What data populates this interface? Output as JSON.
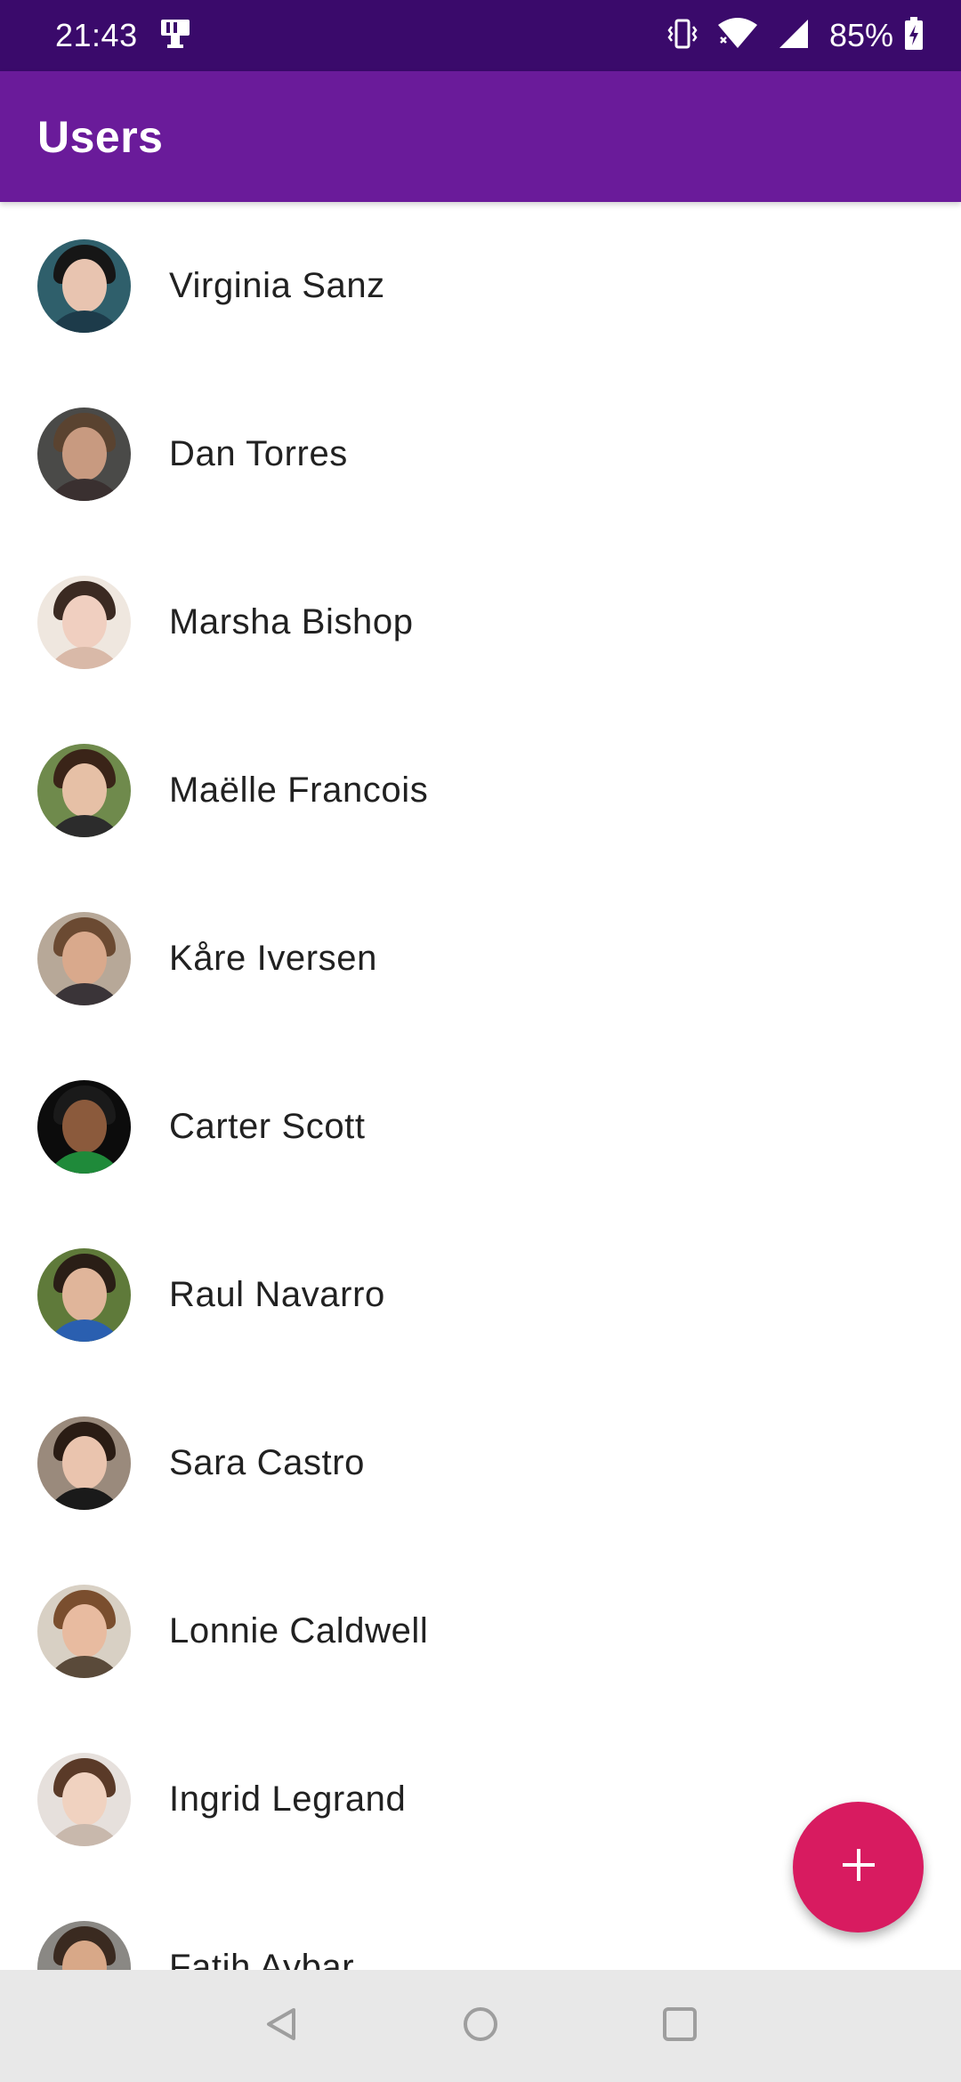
{
  "status_bar": {
    "time": "21:43",
    "battery_percent": "85%",
    "icons": [
      "screen-cast-icon",
      "vibrate-icon",
      "wifi-icon",
      "signal-icon",
      "battery-charging-icon"
    ]
  },
  "app_bar": {
    "title": "Users",
    "color": "#6a1b9a"
  },
  "users": [
    {
      "name": "Virginia Sanz",
      "avatar": {
        "bg": "#2f5f6b",
        "face": "#e8c4b0",
        "hair": "#161616",
        "shirt": "#1d3b4a"
      }
    },
    {
      "name": "Dan Torres",
      "avatar": {
        "bg": "#4a4a48",
        "face": "#c89a80",
        "hair": "#5a4330",
        "shirt": "#3a3030"
      }
    },
    {
      "name": "Marsha Bishop",
      "avatar": {
        "bg": "#efe7df",
        "face": "#f0cfc0",
        "hair": "#3b2a22",
        "shirt": "#d9b9a8"
      }
    },
    {
      "name": "Maëlle Francois",
      "avatar": {
        "bg": "#6f8a4c",
        "face": "#e6c0a6",
        "hair": "#3a2418",
        "shirt": "#2c2c2c"
      }
    },
    {
      "name": "Kåre Iversen",
      "avatar": {
        "bg": "#b7a898",
        "face": "#d9a98c",
        "hair": "#6b4a32",
        "shirt": "#3a3438"
      }
    },
    {
      "name": "Carter Scott",
      "avatar": {
        "bg": "#0c0c0c",
        "face": "#8b5a3c",
        "hair": "#1a1a1a",
        "shirt": "#1f8a3a"
      }
    },
    {
      "name": "Raul Navarro",
      "avatar": {
        "bg": "#5f7a3a",
        "face": "#e0b59a",
        "hair": "#2a1e16",
        "shirt": "#2a5fb0"
      }
    },
    {
      "name": "Sara Castro",
      "avatar": {
        "bg": "#9a8a7c",
        "face": "#eac4ae",
        "hair": "#2a1c14",
        "shirt": "#1a1a1a"
      }
    },
    {
      "name": "Lonnie Caldwell",
      "avatar": {
        "bg": "#d8d0c4",
        "face": "#e8bba0",
        "hair": "#7a4e2e",
        "shirt": "#5a4a3a"
      }
    },
    {
      "name": "Ingrid Legrand",
      "avatar": {
        "bg": "#e6e0dc",
        "face": "#f0d2c0",
        "hair": "#5a3a28",
        "shirt": "#c8b8ac"
      }
    },
    {
      "name": "Fatih Aybar",
      "avatar": {
        "bg": "#8a8884",
        "face": "#d8a888",
        "hair": "#3a2a20",
        "shirt": "#4a4a4a"
      }
    }
  ],
  "fab": {
    "icon": "add-icon",
    "color": "#d81b60"
  },
  "nav_bar": {
    "buttons": [
      "back-icon",
      "home-icon",
      "recents-icon"
    ]
  }
}
